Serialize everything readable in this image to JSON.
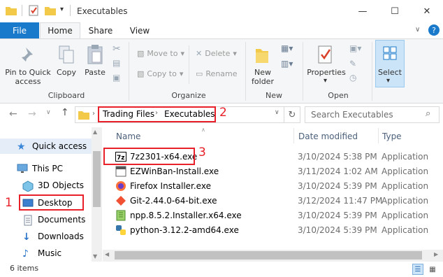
{
  "window": {
    "title": "Executables",
    "minimize": "—",
    "maximize": "☐",
    "close": "✕"
  },
  "menu": {
    "file": "File",
    "tabs": [
      "Home",
      "Share",
      "View"
    ],
    "active_tab": "Home",
    "help": "?"
  },
  "ribbon": {
    "clipboard": {
      "pin_label_line1": "Pin to Quick",
      "pin_label_line2": "access",
      "copy": "Copy",
      "paste": "Paste",
      "group": "Clipboard"
    },
    "organize": {
      "move_to": "Move to",
      "copy_to": "Copy to",
      "delete": "Delete",
      "rename": "Rename",
      "group": "Organize"
    },
    "new": {
      "new_folder_line1": "New",
      "new_folder_line2": "folder",
      "group": "New"
    },
    "open": {
      "properties": "Properties",
      "group": "Open"
    },
    "select": {
      "select": "Select"
    }
  },
  "address": {
    "crumbs": [
      "Trading Files",
      "Executables"
    ],
    "search_placeholder": "Search Executables"
  },
  "annotations": {
    "n1": "1",
    "n2": "2",
    "n3": "3"
  },
  "nav": [
    {
      "label": "Quick access",
      "icon": "star-icon"
    },
    {
      "label": "This PC",
      "icon": "monitor-icon"
    },
    {
      "label": "3D Objects",
      "icon": "cube-icon"
    },
    {
      "label": "Desktop",
      "icon": "desktop-icon"
    },
    {
      "label": "Documents",
      "icon": "document-icon"
    },
    {
      "label": "Downloads",
      "icon": "download-icon"
    },
    {
      "label": "Music",
      "icon": "music-icon"
    }
  ],
  "columns": {
    "name": "Name",
    "date": "Date modified",
    "type": "Type"
  },
  "files": [
    {
      "name": "7z2301-x64.exe",
      "date": "3/10/2024 5:38 PM",
      "type": "Application",
      "icon": "7zip-icon"
    },
    {
      "name": "EZWinBan-Install.exe",
      "date": "3/11/2024 1:02 AM",
      "type": "Application",
      "icon": "installer-icon"
    },
    {
      "name": "Firefox Installer.exe",
      "date": "3/10/2024 5:39 PM",
      "type": "Application",
      "icon": "firefox-icon"
    },
    {
      "name": "Git-2.44.0-64-bit.exe",
      "date": "3/12/2024 11:47 PM",
      "type": "Application",
      "icon": "git-icon"
    },
    {
      "name": "npp.8.5.2.Installer.x64.exe",
      "date": "3/10/2024 5:39 PM",
      "type": "Application",
      "icon": "notepadpp-icon"
    },
    {
      "name": "python-3.12.2-amd64.exe",
      "date": "3/10/2024 5:39 PM",
      "type": "Application",
      "icon": "python-icon"
    }
  ],
  "status": {
    "items": "6 items"
  }
}
